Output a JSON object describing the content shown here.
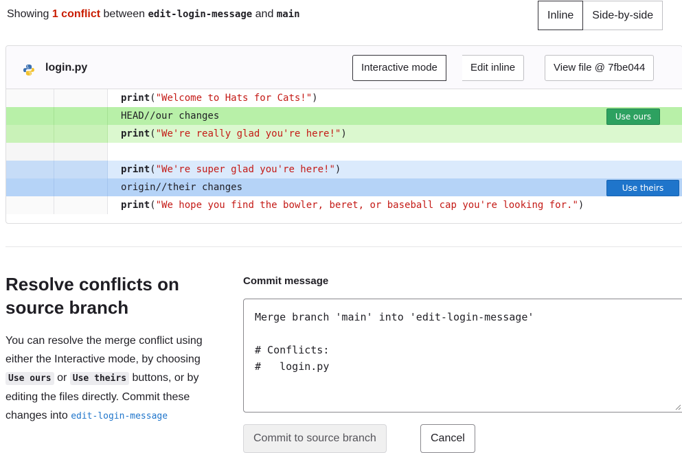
{
  "summary": {
    "prefix": "Showing",
    "count": "1 conflict",
    "between": "between",
    "source_branch": "edit-login-message",
    "and": "and",
    "target_branch": "main"
  },
  "view_toggle": {
    "inline": "Inline",
    "side_by_side": "Side-by-side",
    "active": "Inline"
  },
  "file": {
    "name": "login.py",
    "icon": "python-icon",
    "buttons": {
      "interactive": "Interactive mode",
      "edit_inline": "Edit inline",
      "view_file": "View file @ 7fbe044"
    },
    "lines": [
      {
        "kind": "plain",
        "fn": "print",
        "open": "(",
        "str": "\"Welcome to Hats for Cats!\"",
        "close": ")"
      },
      {
        "kind": "ours-head",
        "text": "HEAD//our changes"
      },
      {
        "kind": "ours",
        "fn": "print",
        "open": "(",
        "str": "\"We're really glad you're here!\"",
        "close": ")"
      },
      {
        "kind": "empty"
      },
      {
        "kind": "theirs",
        "fn": "print",
        "open": "(",
        "str": "\"We're super glad you're here!\"",
        "close": ")"
      },
      {
        "kind": "theirs-head",
        "text": "origin//their changes"
      },
      {
        "kind": "plain",
        "fn": "print",
        "open": "(",
        "str": "\"We hope you find the bowler, beret, or baseball cap you're looking for.\"",
        "close": ")"
      }
    ],
    "use_ours": "Use ours",
    "use_theirs": "Use theirs"
  },
  "resolve": {
    "title": "Resolve conflicts on source branch",
    "desc_1": "You can resolve the merge conflict using either the Interactive mode, by choosing",
    "chip_ours": "Use ours",
    "or": "or",
    "chip_theirs": "Use theirs",
    "desc_2": "buttons, or by editing the files directly. Commit these changes into",
    "branch": "edit-login-message"
  },
  "commit": {
    "label": "Commit message",
    "message": "Merge branch 'main' into 'edit-login-message'\n\n# Conflicts:\n#   login.py",
    "commit_button": "Commit to source branch",
    "cancel_button": "Cancel"
  },
  "colors": {
    "conflict_red": "#c91c00",
    "ours_green": "#2da160",
    "theirs_blue": "#1f75cb"
  }
}
